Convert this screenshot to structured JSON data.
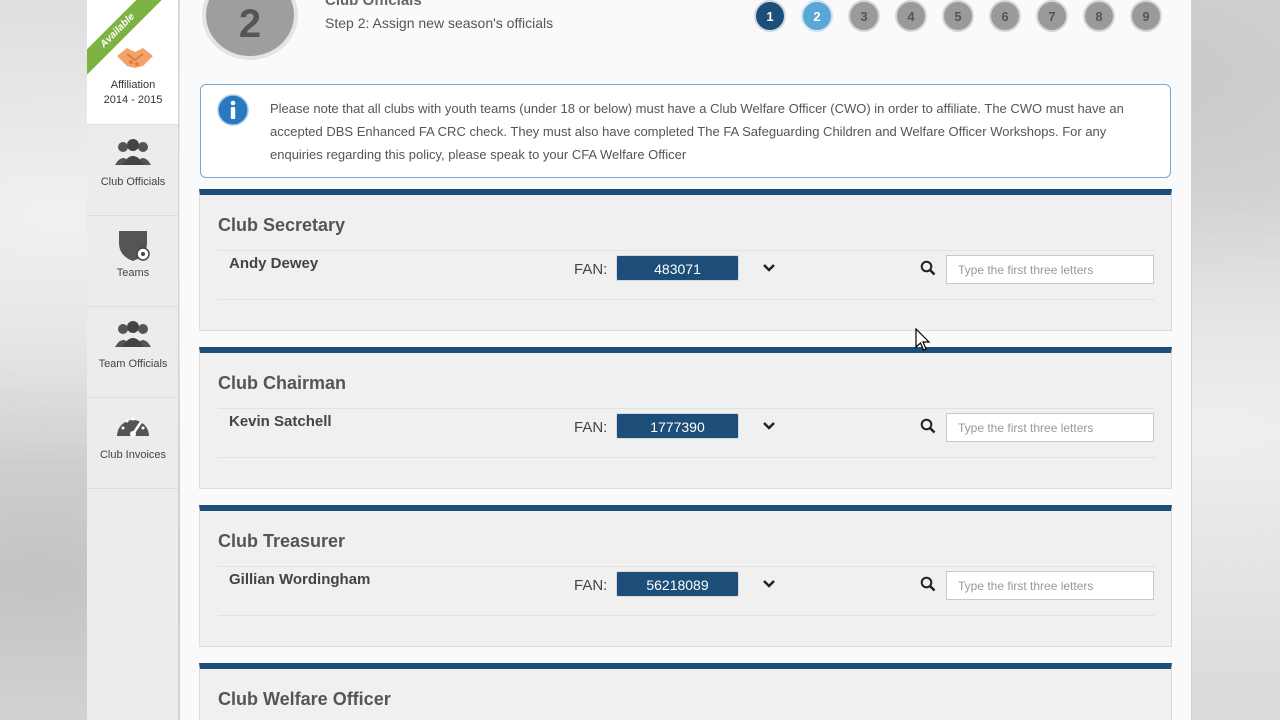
{
  "sidebar": {
    "affiliation": {
      "badge": "Available",
      "label_line1": "Affiliation",
      "label_line2": "2014 - 2015"
    },
    "items": [
      {
        "label": "Club Officials",
        "icon": "people-group-icon"
      },
      {
        "label": "Teams",
        "icon": "shield-football-icon"
      },
      {
        "label": "Team Officials",
        "icon": "people-group-icon"
      },
      {
        "label": "Club Invoices",
        "icon": "speedometer-icon"
      }
    ]
  },
  "header": {
    "step_number": "2",
    "title": "Club Officials",
    "subtitle": "Step 2: Assign new season's officials",
    "steps": [
      "1",
      "2",
      "3",
      "4",
      "5",
      "6",
      "7",
      "8",
      "9"
    ]
  },
  "notice": {
    "icon": "info-icon",
    "text": "Please note that all clubs with youth teams (under 18 or below) must have a Club Welfare Officer (CWO) in order to affiliate. The CWO must have an accepted DBS Enhanced FA CRC check. They must also have completed The FA Safeguarding Children and Welfare Officer Workshops. For any enquiries regarding this policy, please speak to your CFA Welfare Officer"
  },
  "panels": [
    {
      "title": "Club Secretary",
      "name": "Andy Dewey",
      "fan_label": "FAN:",
      "fan": "483071",
      "search_placeholder": "Type the first three letters"
    },
    {
      "title": "Club Chairman",
      "name": "Kevin Satchell",
      "fan_label": "FAN:",
      "fan": "1777390",
      "search_placeholder": "Type the first three letters"
    },
    {
      "title": "Club Treasurer",
      "name": "Gillian Wordingham",
      "fan_label": "FAN:",
      "fan": "56218089",
      "search_placeholder": "Type the first three letters"
    },
    {
      "title": "Club Welfare Officer"
    }
  ],
  "colors": {
    "primary": "#1d4e79",
    "active_step": "#5aa6d6",
    "badge": "#7cb342"
  }
}
